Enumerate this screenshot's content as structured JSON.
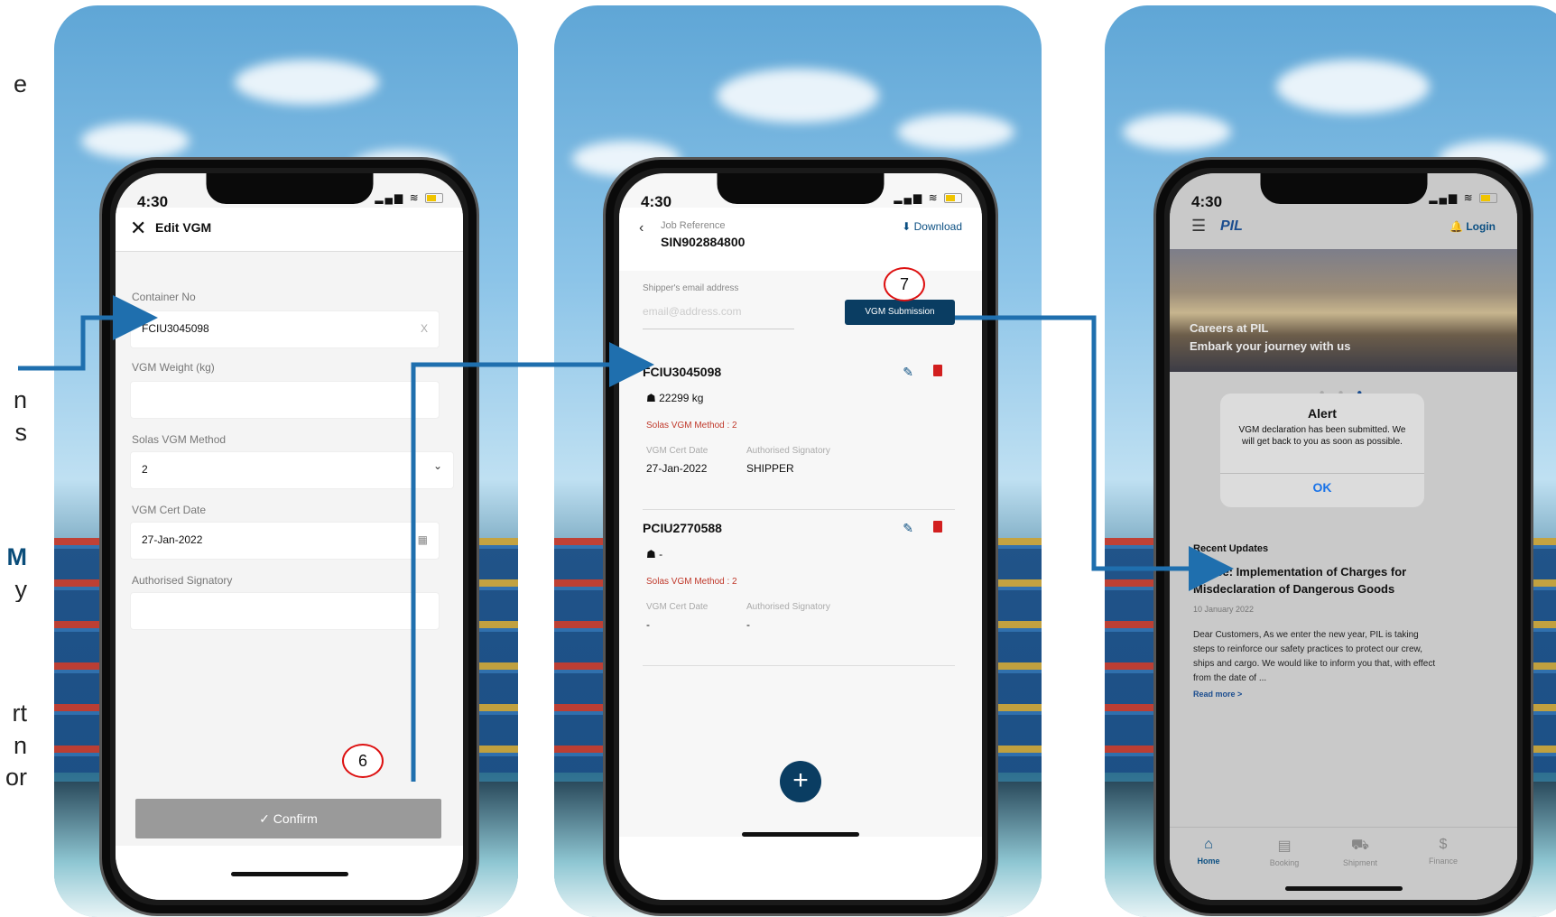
{
  "side_text": [
    "e",
    "n",
    "s",
    "M",
    "y",
    "rt",
    "n",
    "or"
  ],
  "screen1": {
    "time": "4:30",
    "title": "Edit VGM",
    "fields": [
      {
        "label": "Container No",
        "value": "FCIU3045098",
        "suffix": "X"
      },
      {
        "label": "VGM Weight (kg)",
        "value": "",
        "suffix": ""
      },
      {
        "label": "Solas VGM Method",
        "value": "2",
        "suffix": "⌄"
      },
      {
        "label": "VGM Cert Date",
        "value": "27-Jan-2022",
        "suffix": "▦"
      },
      {
        "label": "Authorised Signatory",
        "value": "",
        "suffix": ""
      }
    ],
    "confirm_label": "✓  Confirm"
  },
  "screen2": {
    "time": "4:30",
    "job_ref_label": "Job Reference",
    "job_ref": "SIN902884800",
    "download_label": "⬇ Download",
    "email_label": "Shipper's email address",
    "email_placeholder": "email@address.com",
    "vgm_button": "VGM Submission",
    "containers": [
      {
        "id": "FCIU3045098",
        "weight": "☗ 22299 kg",
        "solas": "Solas VGM Method : 2",
        "cert_label": "VGM Cert Date",
        "sig_label": "Authorised Signatory",
        "cert_date": "27-Jan-2022",
        "signatory": "SHIPPER"
      },
      {
        "id": "PCIU2770588",
        "weight": "☗  -",
        "solas": "Solas VGM Method : 2",
        "cert_label": "VGM Cert Date",
        "sig_label": "Authorised Signatory",
        "cert_date": "-",
        "signatory": "-"
      }
    ]
  },
  "screen3": {
    "time": "4:30",
    "logo": "PIL",
    "login": "Login",
    "banner_line1": "Careers at PIL",
    "banner_line2": "Embark your journey with us",
    "alert_title": "Alert",
    "alert_message": "VGM declaration has been submitted. We will get back to you as soon as possible.",
    "alert_ok": "OK",
    "recent_updates": "Recent Updates",
    "news_title": "Notice: Implementation of Charges for Misdeclaration of Dangerous Goods",
    "news_date": "10 January 2022",
    "news_body": "Dear Customers, As we enter the new year, PIL is taking steps to reinforce our safety practices to protect our crew, ships and cargo.  We would like to inform you that, with effect from the date of ...",
    "read_more": "Read more >",
    "tabs": [
      {
        "label": "Home",
        "icon": "⌂"
      },
      {
        "label": "Booking",
        "icon": "▤"
      },
      {
        "label": "Shipment",
        "icon": "⛟"
      },
      {
        "label": "Finance",
        "icon": "$"
      }
    ]
  },
  "steps": [
    "6",
    "7"
  ],
  "colors": {
    "connector": "#1f6fae",
    "step_circle": "#dd1111",
    "primary": "#0a3d62"
  }
}
